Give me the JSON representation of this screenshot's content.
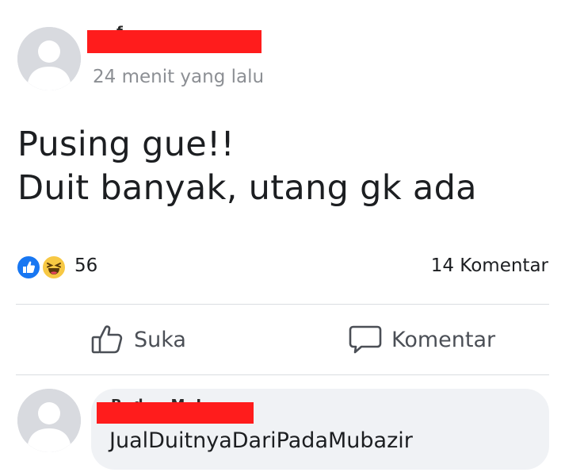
{
  "post": {
    "author_name": "",
    "timestamp": "24 menit yang lalu",
    "body_lines": [
      "Pusing gue!!",
      "Duit banyak, utang gk ada"
    ],
    "reaction_icons": [
      "like-icon",
      "haha-icon"
    ],
    "reaction_count": "56",
    "comment_count": "14 Komentar"
  },
  "actions": {
    "like_label": "Suka",
    "comment_label": "Komentar"
  },
  "comment": {
    "author_name": "",
    "text": "JualDuitnyaDariPadaMubazir"
  },
  "colors": {
    "redaction": "#ff1c1c",
    "like_blue": "#1877f2",
    "haha_yellow": "#f7c844",
    "bubble_bg": "#f0f2f5",
    "muted_text": "#8c8f94"
  }
}
